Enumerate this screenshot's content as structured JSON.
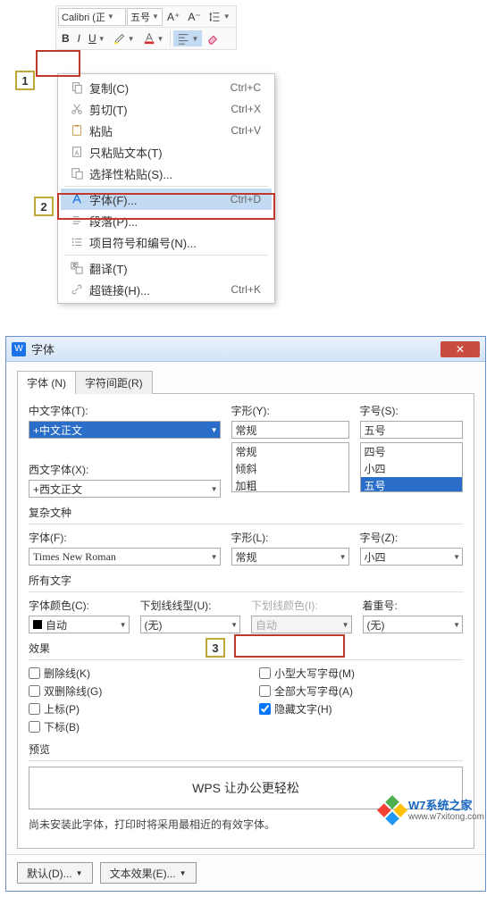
{
  "toolbar": {
    "font_name": "Calibri (正",
    "font_size": "五号",
    "grow_label": "A⁺",
    "shrink_label": "A⁻",
    "bold": "B",
    "italic": "I",
    "underline": "U"
  },
  "callouts": {
    "one": "1",
    "two": "2",
    "three": "3"
  },
  "context_menu": {
    "copy": "复制(C)",
    "copy_sc": "Ctrl+C",
    "cut": "剪切(T)",
    "cut_sc": "Ctrl+X",
    "paste": "粘贴",
    "paste_sc": "Ctrl+V",
    "paste_text": "只粘贴文本(T)",
    "paste_special": "选择性粘贴(S)...",
    "font": "字体(F)...",
    "font_sc": "Ctrl+D",
    "paragraph": "段落(P)...",
    "bullets": "项目符号和编号(N)...",
    "translate": "翻译(T)",
    "hyperlink": "超链接(H)...",
    "hyperlink_sc": "Ctrl+K"
  },
  "dialog": {
    "title": "字体",
    "tab_font": "字体 (N)",
    "tab_spacing": "字符间距(R)",
    "chinese_font_label": "中文字体(T):",
    "chinese_font_value": "+中文正文",
    "style_label": "字形(Y):",
    "style_value": "常规",
    "style_options": [
      "常规",
      "倾斜",
      "加粗"
    ],
    "size_label": "字号(S):",
    "size_value": "五号",
    "size_options": [
      "四号",
      "小四",
      "五号"
    ],
    "western_font_label": "西文字体(X):",
    "western_font_value": "+西文正文",
    "complex_title": "复杂文种",
    "complex_font_label": "字体(F):",
    "complex_font_value": "Times New Roman",
    "complex_style_label": "字形(L):",
    "complex_style_value": "常规",
    "complex_size_label": "字号(Z):",
    "complex_size_value": "小四",
    "alltext_title": "所有文字",
    "font_color_label": "字体颜色(C):",
    "font_color_value": "自动",
    "underline_style_label": "下划线线型(U):",
    "underline_style_value": "(无)",
    "underline_color_label": "下划线颜色(I):",
    "underline_color_value": "自动",
    "emphasis_label": "着重号:",
    "emphasis_value": "(无)",
    "effects_title": "效果",
    "fx_strikethrough": "删除线(K)",
    "fx_dbl_strikethrough": "双删除线(G)",
    "fx_superscript": "上标(P)",
    "fx_subscript": "下标(B)",
    "fx_small_caps": "小型大写字母(M)",
    "fx_all_caps": "全部大写字母(A)",
    "fx_hidden": "隐藏文字(H)",
    "preview_title": "预览",
    "preview_text": "WPS 让办公更轻松",
    "hint": "尚未安装此字体，打印时将采用最相近的有效字体。",
    "btn_default": "默认(D)...",
    "btn_text_effects": "文本效果(E)..."
  },
  "brand": {
    "name": "W7系统之家",
    "url": "www.w7xitong.com"
  }
}
